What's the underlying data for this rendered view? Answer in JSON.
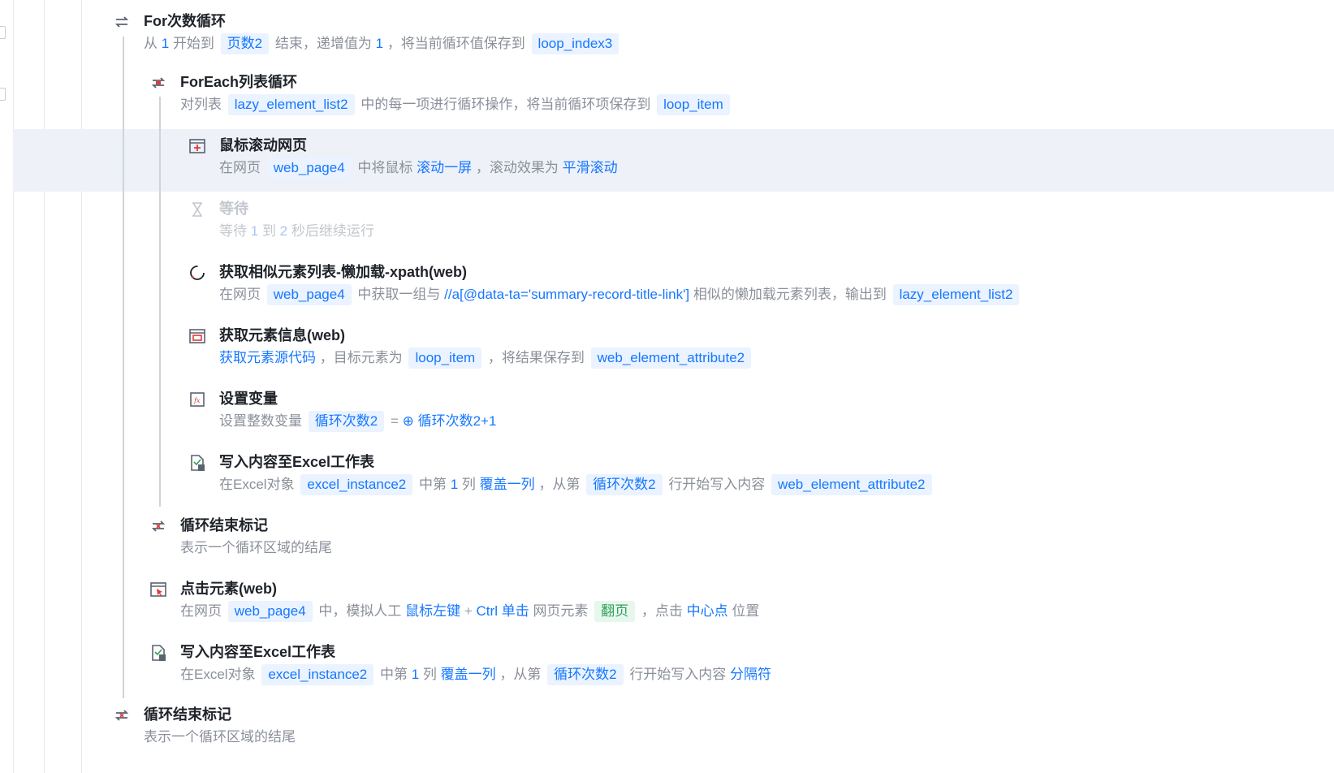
{
  "colors": {
    "accent": "#1677ff",
    "tag_bg": "#eaf3ff",
    "highlight_bg": "#eef1f8",
    "muted": "#8a8f99",
    "green": "#2ea05a",
    "red": "#e03a3a"
  },
  "steps": [
    {
      "icon": "loop-icon",
      "title": "For次数循环",
      "desc": {
        "t1": "从",
        "v1": "1",
        "t2": "开始到",
        "v2": "页数2",
        "t3": "结束，递增值为",
        "v3": "1",
        "t4": "，将当前循环值保存到",
        "v4": "loop_index3"
      }
    },
    {
      "icon": "foreach-icon",
      "title": "ForEach列表循环",
      "desc": {
        "t1": "对列表",
        "v1": "lazy_element_list2",
        "t2": "中的每一项进行循环操作，将当前循环项保存到",
        "v2": "loop_item"
      }
    },
    {
      "icon": "mouse-scroll-icon",
      "title": "鼠标滚动网页",
      "selected": true,
      "desc": {
        "t1": "在网页",
        "v1": "web_page4",
        "t2": "中将鼠标",
        "v2": "滚动一屏",
        "t3": "，滚动效果为",
        "v3": "平滑滚动"
      }
    },
    {
      "icon": "hourglass-icon",
      "title": "等待",
      "disabled": true,
      "desc": {
        "t1": "等待",
        "v1": "1",
        "t2": "到",
        "v2": "2",
        "t3": "秒后继续运行"
      }
    },
    {
      "icon": "loading-icon",
      "title": "获取相似元素列表-懒加载-xpath(web)",
      "desc": {
        "t1": "在网页",
        "v1": "web_page4",
        "t2": "中获取一组与",
        "v2": "//a[@data-ta='summary-record-title-link']",
        "t3": "相似的懒加载元素列表，输出到",
        "v3": "lazy_element_list2"
      }
    },
    {
      "icon": "element-info-icon",
      "title": "获取元素信息(web)",
      "desc": {
        "v1": "获取元素源代码",
        "t1": "，目标元素为",
        "v2": "loop_item",
        "t2": "，将结果保存到",
        "v3": "web_element_attribute2"
      }
    },
    {
      "icon": "variable-fx-icon",
      "title": "设置变量",
      "desc": {
        "t1": "设置整数变量",
        "v1": "循环次数2",
        "op": "=",
        "v2": "循环次数2+1"
      }
    },
    {
      "icon": "excel-write-icon",
      "title": "写入内容至Excel工作表",
      "desc": {
        "t1": "在Excel对象",
        "v1": "excel_instance2",
        "t2": "中第",
        "v2": "1",
        "t3": "列",
        "v3": "覆盖一列",
        "t4": "，从第",
        "v4": "循环次数2",
        "t5": "行开始写入内容",
        "v5": "web_element_attribute2"
      }
    },
    {
      "icon": "loop-end-icon",
      "title": "循环结束标记",
      "desc": {
        "t1": "表示一个循环区域的结尾"
      }
    },
    {
      "icon": "click-element-icon",
      "title": "点击元素(web)",
      "desc": {
        "t1": "在网页",
        "v1": "web_page4",
        "t2": "中，模拟人工",
        "v2": "鼠标左键",
        "op": "+",
        "v3": "Ctrl 单击",
        "t3": "网页元素",
        "v4": "翻页",
        "t4": "，点击",
        "v5": "中心点",
        "t5": "位置"
      }
    },
    {
      "icon": "excel-write-icon",
      "title": "写入内容至Excel工作表",
      "desc": {
        "t1": "在Excel对象",
        "v1": "excel_instance2",
        "t2": "中第",
        "v2": "1",
        "t3": "列",
        "v3": "覆盖一列",
        "t4": "，从第",
        "v4": "循环次数2",
        "t5": "行开始写入内容",
        "v5": "分隔符"
      }
    },
    {
      "icon": "loop-end-icon",
      "title": "循环结束标记",
      "desc": {
        "t1": "表示一个循环区域的结尾"
      }
    }
  ]
}
